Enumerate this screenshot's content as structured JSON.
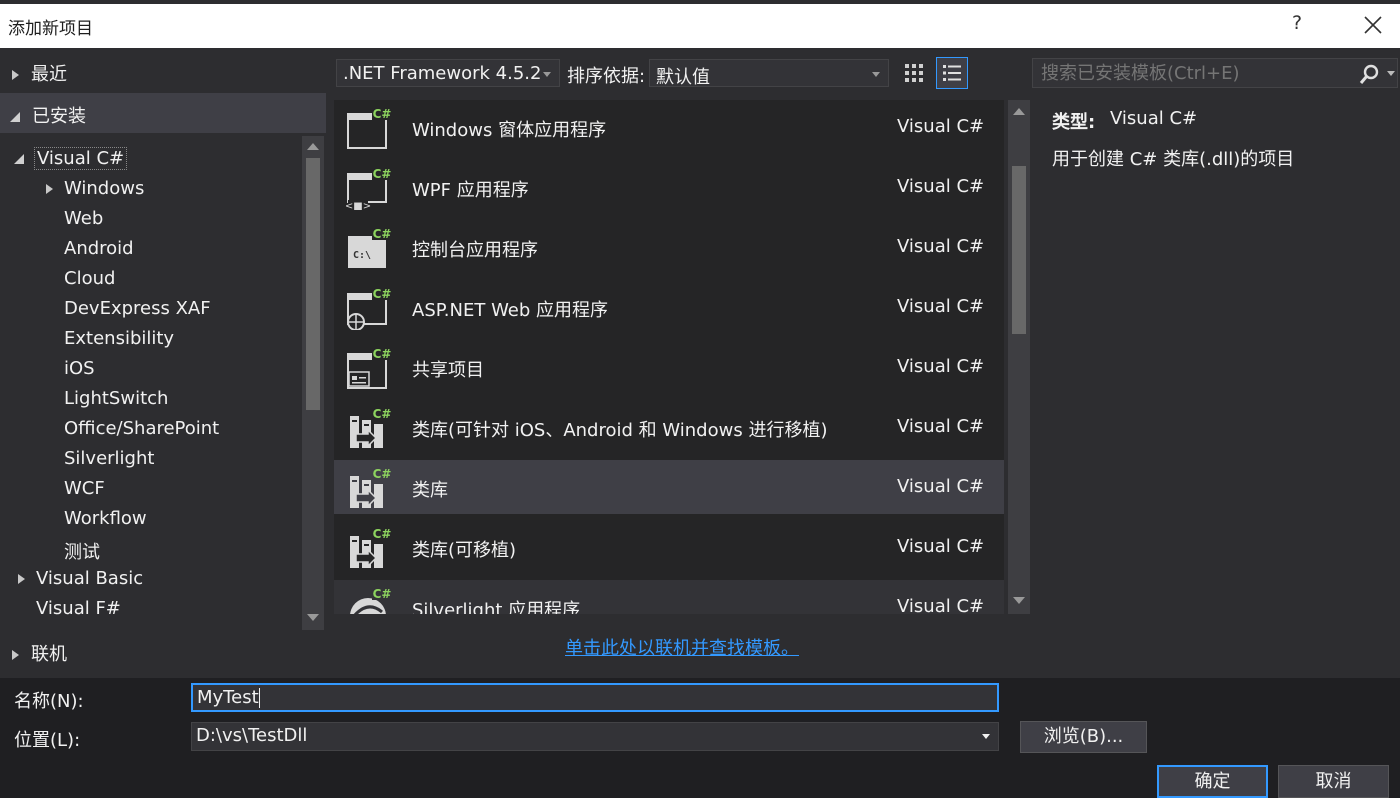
{
  "window": {
    "title": "添加新项目",
    "help": "?"
  },
  "tree": {
    "recent": "最近",
    "installed": "已安装",
    "visual_csharp": "Visual C#",
    "children": [
      "Windows",
      "Web",
      "Android",
      "Cloud",
      "DevExpress XAF",
      "Extensibility",
      "iOS",
      "LightSwitch",
      "Office/SharePoint",
      "Silverlight",
      "WCF",
      "Workflow",
      "测试"
    ],
    "visual_basic": "Visual Basic",
    "visual_fsharp": "Visual F#",
    "online": "联机"
  },
  "toolbar": {
    "framework": ".NET Framework 4.5.2",
    "sort_label": "排序依据:",
    "sort_value": "默认值"
  },
  "search": {
    "placeholder": "搜索已安装模板(Ctrl+E)"
  },
  "templates": [
    {
      "name": "Windows 窗体应用程序",
      "lang": "Visual C#",
      "icon": "winforms-icon"
    },
    {
      "name": "WPF 应用程序",
      "lang": "Visual C#",
      "icon": "wpf-icon"
    },
    {
      "name": "控制台应用程序",
      "lang": "Visual C#",
      "icon": "console-icon"
    },
    {
      "name": "ASP.NET Web 应用程序",
      "lang": "Visual C#",
      "icon": "aspnet-icon"
    },
    {
      "name": "共享项目",
      "lang": "Visual C#",
      "icon": "shared-project-icon"
    },
    {
      "name": "类库(可针对 iOS、Android 和 Windows 进行移植)",
      "lang": "Visual C#",
      "icon": "portable-library-icon"
    },
    {
      "name": "类库",
      "lang": "Visual C#",
      "icon": "class-library-icon",
      "selected": true
    },
    {
      "name": "类库(可移植)",
      "lang": "Visual C#",
      "icon": "portable-library-icon"
    },
    {
      "name": "Silverlight 应用程序",
      "lang": "Visual C#",
      "icon": "silverlight-icon"
    }
  ],
  "details": {
    "type_label": "类型:",
    "type_value": "Visual C#",
    "description": "用于创建 C# 类库(.dll)的项目"
  },
  "online_link": "单击此处以联机并查找模板。",
  "form": {
    "name_label": "名称(N):",
    "name_value": "MyTest",
    "location_label": "位置(L):",
    "location_value": "D:\\vs\\TestDll",
    "browse": "浏览(B)...",
    "ok": "确定",
    "cancel": "取消"
  },
  "colors": {
    "background": "#2d2d30",
    "accent": "#3399ff",
    "csharp_badge": "#8dd35f"
  }
}
